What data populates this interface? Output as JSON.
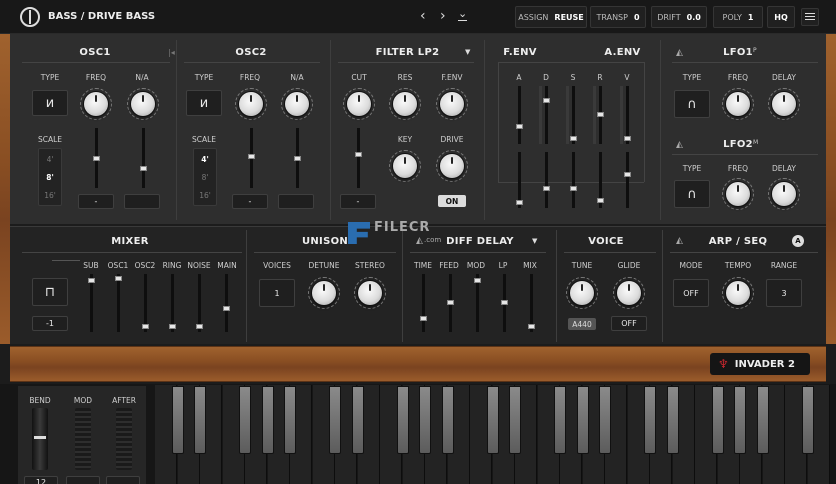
{
  "header": {
    "preset_name": "BASS / DRIVE BASS",
    "assign_label": "ASSIGN",
    "assign_value": "REUSE",
    "transp_label": "TRANSP",
    "transp_value": "0",
    "drift_label": "DRIFT",
    "drift_value": "0.0",
    "poly_label": "POLY",
    "poly_value": "1",
    "hq_label": "HQ"
  },
  "osc1": {
    "title": "OSC1",
    "type_label": "TYPE",
    "freq_label": "FREQ",
    "na_label": "N/A",
    "scale_label": "SCALE",
    "scales": [
      "4'",
      "8'",
      "16'"
    ],
    "btn1": "-",
    "btn2": ""
  },
  "osc2": {
    "title": "OSC2",
    "type_label": "TYPE",
    "freq_label": "FREQ",
    "na_label": "N/A",
    "scale_label": "SCALE",
    "scales": [
      "4'",
      "8'",
      "16'"
    ],
    "btn1": "-",
    "btn2": ""
  },
  "filter": {
    "title": "FILTER LP2",
    "cut_label": "CUT",
    "res_label": "RES",
    "fenv_label": "F.ENV",
    "key_label": "KEY",
    "drive_label": "DRIVE",
    "drive_value": "ON",
    "btn": "-"
  },
  "envelopes": {
    "fenv_title": "F.ENV",
    "aenv_title": "A.ENV",
    "stages": [
      "A",
      "D",
      "S",
      "R",
      "V"
    ]
  },
  "lfo1": {
    "title": "LFO1",
    "badge": "P",
    "type_label": "TYPE",
    "freq_label": "FREQ",
    "delay_label": "DELAY"
  },
  "lfo2": {
    "title": "LFO2",
    "badge": "M",
    "type_label": "TYPE",
    "freq_label": "FREQ",
    "delay_label": "DELAY"
  },
  "mixer": {
    "title": "MIXER",
    "channels": [
      "SUB",
      "OSC1",
      "OSC2",
      "RING",
      "NOISE",
      "MAIN"
    ],
    "value": "-1"
  },
  "unison": {
    "title": "UNISON",
    "voices_label": "VOICES",
    "voices_value": "1",
    "detune_label": "DETUNE",
    "stereo_label": "STEREO"
  },
  "delay": {
    "title": "DIFF DELAY",
    "params": [
      "TIME",
      "FEED",
      "MOD",
      "LP",
      "MIX"
    ]
  },
  "voice": {
    "title": "VOICE",
    "tune_label": "TUNE",
    "tune_value": "A440",
    "glide_label": "GLIDE",
    "glide_value": "OFF"
  },
  "arp": {
    "title": "ARP / SEQ",
    "badge": "A",
    "mode_label": "MODE",
    "mode_value": "OFF",
    "tempo_label": "TEMPO",
    "range_label": "RANGE",
    "range_value": "3"
  },
  "brand": {
    "name": "INVADER 2"
  },
  "watermark": {
    "text": "FILECR",
    "sub": ".com"
  },
  "wheels": {
    "bend_label": "BEND",
    "mod_label": "MOD",
    "after_label": "AFTER",
    "octave_value": "12"
  },
  "colors": {
    "accent_red": "#c1272d",
    "panel": "#2e2e2e",
    "wood": "#8a4f23"
  }
}
